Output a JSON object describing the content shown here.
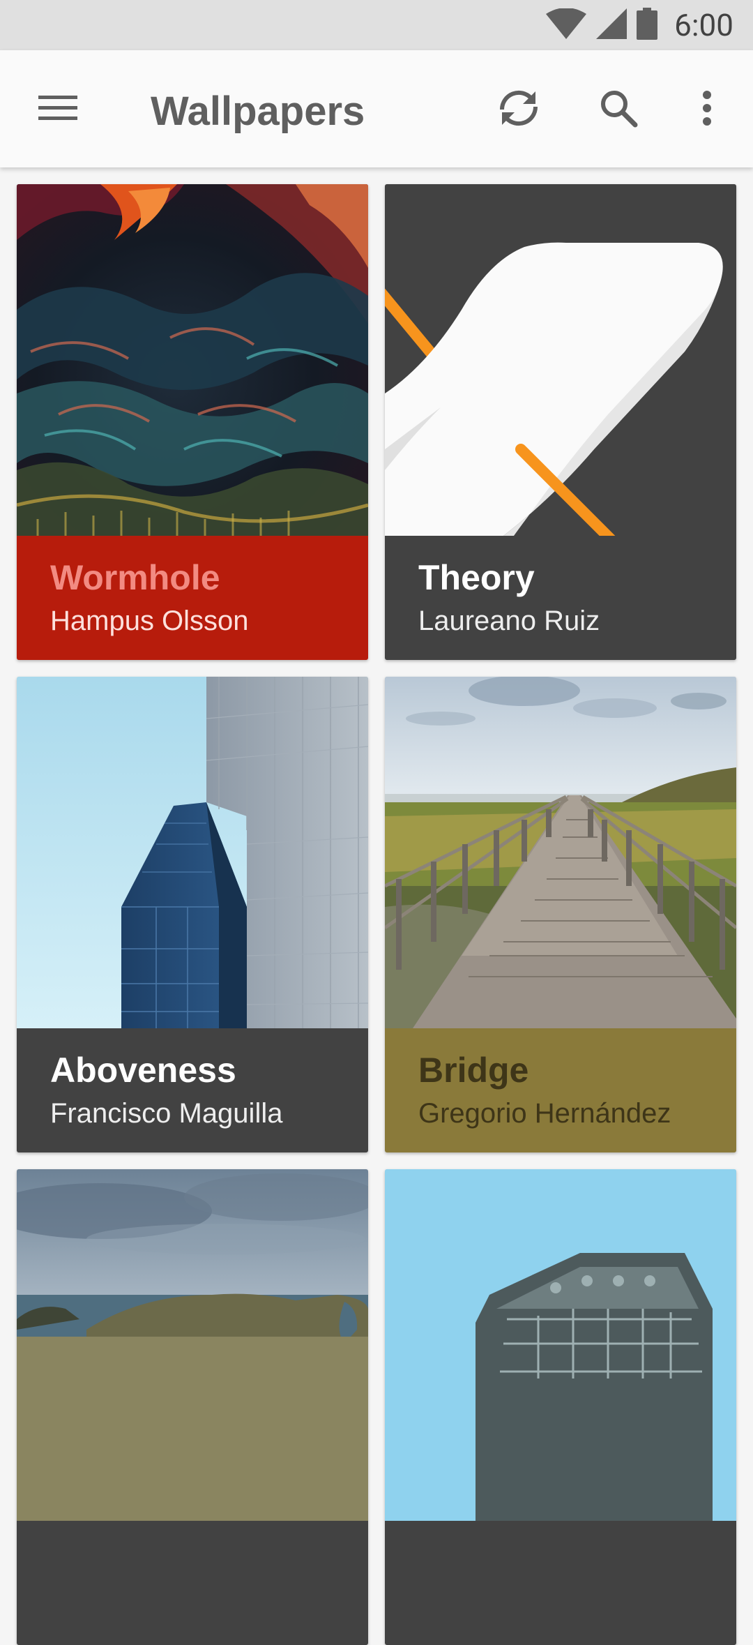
{
  "status_bar": {
    "time": "6:00",
    "icons": [
      "wifi-icon",
      "signal-icon",
      "battery-icon"
    ]
  },
  "app_bar": {
    "title": "Wallpapers",
    "menu_icon": "menu-icon",
    "actions": [
      "refresh-icon",
      "search-icon",
      "more-vert-icon"
    ]
  },
  "wallpapers": [
    {
      "name": "Wormhole",
      "author": "Hampus Olsson",
      "caption_color": "#b71c0c",
      "name_color": "#f28b82",
      "author_color": "#fde0dc"
    },
    {
      "name": "Theory",
      "author": "Laureano Ruiz",
      "caption_color": "#424242",
      "name_color": "#ffffff",
      "author_color": "#eeeeee"
    },
    {
      "name": "Aboveness",
      "author": "Francisco Maguilla",
      "caption_color": "#424242",
      "name_color": "#ffffff",
      "author_color": "#eeeeee"
    },
    {
      "name": "Bridge",
      "author": "Gregorio Hernández",
      "caption_color": "#8a7a3a",
      "name_color": "#3e3518",
      "author_color": "#3e3518"
    },
    {
      "name": "",
      "author": ""
    },
    {
      "name": "",
      "author": ""
    }
  ]
}
